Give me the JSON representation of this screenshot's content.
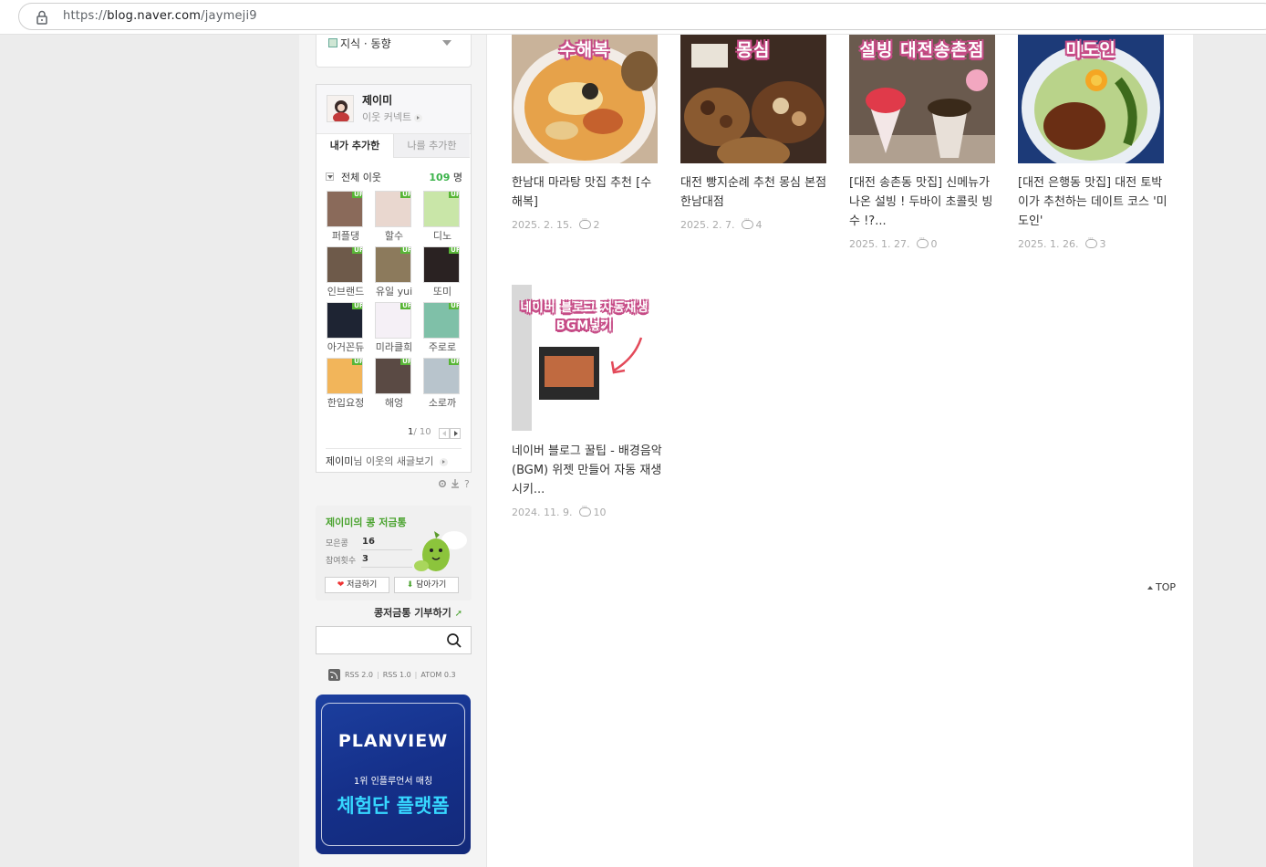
{
  "browser": {
    "url_scheme": "https://",
    "url_host": "blog.naver.com",
    "url_path": "/jaymeji9"
  },
  "sidebar": {
    "category": {
      "label": "지식 · 동향"
    },
    "buddy": {
      "name": "제이미",
      "connect_label": "이웃 커넥트",
      "tab_added_by_me": "내가 추가한",
      "tab_added_me": "나를 추가한",
      "all_label": "전체 이웃",
      "count": "109",
      "count_unit": "명",
      "neighbors": [
        {
          "name": "퍼플댕",
          "up": "UP",
          "color": "#8a6a5a"
        },
        {
          "name": "할수",
          "up": "UP",
          "color": "#e9d7cf"
        },
        {
          "name": "디노",
          "up": "UP",
          "color": "#c9e6a8"
        },
        {
          "name": "인브랜드",
          "up": "UP",
          "color": "#6e5a4a"
        },
        {
          "name": "유일 yui",
          "up": "UP",
          "color": "#8c7a5c"
        },
        {
          "name": "또미",
          "up": "UP",
          "color": "#2a2222"
        },
        {
          "name": "아거꼰듀",
          "up": "UP",
          "color": "#1e2433"
        },
        {
          "name": "미라클희",
          "up": "UP",
          "color": "#f5f0f6"
        },
        {
          "name": "주로로",
          "up": "UP",
          "color": "#7fc0a8"
        },
        {
          "name": "한입요정",
          "up": "UP",
          "color": "#f2b55a"
        },
        {
          "name": "해엉",
          "up": "UP",
          "color": "#5a4a44"
        },
        {
          "name": "소로까",
          "up": "UP",
          "color": "#b8c4cc"
        }
      ],
      "page_current": "1",
      "page_total": "/ 10",
      "feed_owner": "제이미",
      "feed_text": "님 이웃의 새글보기"
    },
    "bean": {
      "title": "제이미의 콩 저금통",
      "collected_label": "모은콩",
      "collected_value": "16",
      "participants_label": "참여횟수",
      "participants_value": "3",
      "save_label": "저금하기",
      "take_label": "담아가기",
      "donate_label": "콩저금통 기부하기"
    },
    "search": {
      "placeholder": ""
    },
    "feeds": {
      "rss2": "RSS 2.0",
      "rss1": "RSS 1.0",
      "atom": "ATOM 0.3"
    },
    "ad": {
      "brand": "PLANVIEW",
      "sub": "1위 인플루언서 매칭",
      "headline": "체험단 플랫폼"
    }
  },
  "posts": [
    {
      "badge": "수해복",
      "title": "한남대 마라탕 맛집 추천 [수해복]",
      "date": "2025. 2. 15.",
      "comments": "2"
    },
    {
      "badge": "몽심",
      "title": "대전 빵지순례 추천 몽심 본점 한남대점",
      "date": "2025. 2. 7.",
      "comments": "4"
    },
    {
      "badge": "설빙 대전송촌점",
      "title": "[대전 송촌동 맛집] 신메뉴가 나온 설빙 ! 두바이 초콜릿 빙수 !?...",
      "date": "2025. 1. 27.",
      "comments": "0"
    },
    {
      "badge": "미도인",
      "title": "[대전 은행동 맛집] 대전 토박이가 추천하는 데이트 코스 '미도인'",
      "date": "2025. 1. 26.",
      "comments": "3"
    },
    {
      "badge": "네이버 블로그 자동재생 BGM넣기",
      "title": "네이버 블로그 꿀팁 - 배경음악(BGM) 위젯 만들어 자동 재생 시키...",
      "date": "2024. 11. 9.",
      "comments": "10"
    }
  ],
  "top_link": "TOP"
}
